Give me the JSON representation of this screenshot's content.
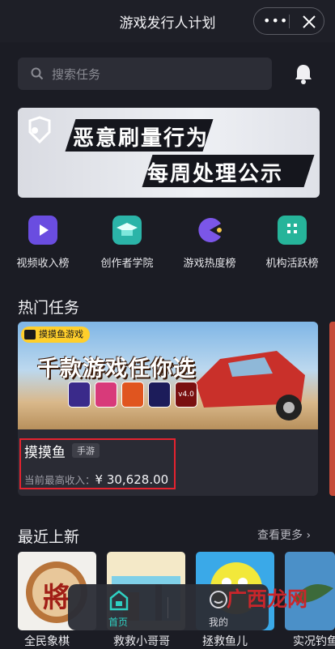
{
  "nav": {
    "title": "游戏发行人计划",
    "more_label": "•••"
  },
  "search": {
    "placeholder": "搜索任务"
  },
  "banner": {
    "line1": "恶意刷量行为",
    "line2": "每周处理公示"
  },
  "categories": [
    {
      "label": "视频收入榜",
      "icon": "video-income-icon",
      "color": "#6a4de0"
    },
    {
      "label": "创作者学院",
      "icon": "graduation-cap-icon",
      "color": "#2bb4a8"
    },
    {
      "label": "游戏热度榜",
      "icon": "pacman-icon",
      "color": "#7b56e8"
    },
    {
      "label": "机构活跃榜",
      "icon": "building-icon",
      "color": "#26b49a"
    }
  ],
  "hot": {
    "title": "热门任务",
    "card": {
      "tag": "摸摸鱼游戏",
      "headline": "千款游戏任你选",
      "version": "v4.0",
      "name": "摸摸鱼",
      "badge": "手游",
      "income_label": "当前最高收入：",
      "income_value": "¥ 30,628.00"
    }
  },
  "recent": {
    "title": "最近上新",
    "more": "查看更多 ›",
    "items": [
      {
        "label": "全民象棋",
        "char": "將"
      },
      {
        "label": "救救小哥哥"
      },
      {
        "label": "拯救鱼儿"
      },
      {
        "label": "实况钓鱼"
      }
    ]
  },
  "tabbar": {
    "home": "首页",
    "mine": "我的"
  },
  "watermark": "广西龙网",
  "colors": {
    "accent": "#2fd0c2",
    "highlight": "#e5232f",
    "tag": "#ffcf2b"
  }
}
